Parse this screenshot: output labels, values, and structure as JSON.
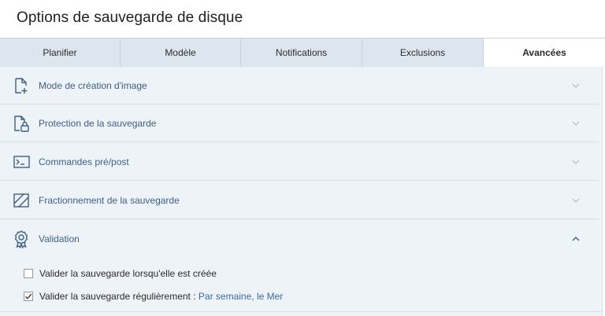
{
  "window": {
    "title": "Options de sauvegarde de disque"
  },
  "tabs": [
    {
      "label": "Planifier"
    },
    {
      "label": "Modèle"
    },
    {
      "label": "Notifications"
    },
    {
      "label": "Exclusions"
    },
    {
      "label": "Avancées",
      "active": true
    }
  ],
  "sections": [
    {
      "label": "Mode de création d'image",
      "icon": "file-add-icon",
      "expanded": false
    },
    {
      "label": "Protection de la sauvegarde",
      "icon": "file-lock-icon",
      "expanded": false
    },
    {
      "label": "Commandes pré/post",
      "icon": "terminal-icon",
      "expanded": false
    },
    {
      "label": "Fractionnement de la sauvegarde",
      "icon": "split-icon",
      "expanded": false
    },
    {
      "label": "Validation",
      "icon": "award-icon",
      "expanded": true
    }
  ],
  "validation": {
    "option1": {
      "label": "Valider la sauvegarde lorsqu'elle est créée",
      "checked": false
    },
    "option2": {
      "label": "Valider la sauvegarde régulièrement :",
      "link": "Par semaine, le Mer",
      "checked": true
    }
  },
  "colors": {
    "accent": "#3d5f86",
    "panel_bg": "#eef3f8",
    "tab_bg": "#dde6ee",
    "link": "#3b6aa0"
  }
}
